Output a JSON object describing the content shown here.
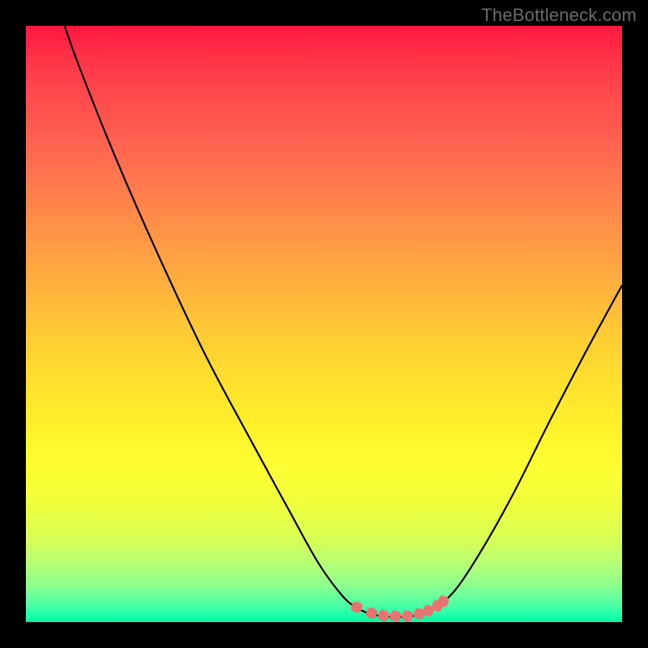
{
  "watermark": "TheBottleneck.com",
  "chart_data": {
    "type": "line",
    "title": "",
    "xlabel": "",
    "ylabel": "",
    "xlim": [
      0,
      100
    ],
    "ylim": [
      0,
      100
    ],
    "series": [
      {
        "name": "curve",
        "points": [
          {
            "x": 6.5,
            "y": 100.0
          },
          {
            "x": 9.0,
            "y": 93.0
          },
          {
            "x": 15.0,
            "y": 78.0
          },
          {
            "x": 22.0,
            "y": 62.0
          },
          {
            "x": 30.0,
            "y": 45.0
          },
          {
            "x": 38.0,
            "y": 30.0
          },
          {
            "x": 44.0,
            "y": 19.0
          },
          {
            "x": 49.0,
            "y": 10.0
          },
          {
            "x": 53.0,
            "y": 4.5
          },
          {
            "x": 55.5,
            "y": 2.4
          },
          {
            "x": 58.0,
            "y": 1.3
          },
          {
            "x": 61.0,
            "y": 0.9
          },
          {
            "x": 64.0,
            "y": 0.9
          },
          {
            "x": 67.0,
            "y": 1.5
          },
          {
            "x": 69.5,
            "y": 3.0
          },
          {
            "x": 72.5,
            "y": 6.0
          },
          {
            "x": 77.0,
            "y": 13.0
          },
          {
            "x": 82.0,
            "y": 22.0
          },
          {
            "x": 88.0,
            "y": 34.0
          },
          {
            "x": 94.0,
            "y": 45.5
          },
          {
            "x": 100.0,
            "y": 56.5
          }
        ]
      },
      {
        "name": "markers",
        "type": "scatter",
        "points": [
          {
            "x": 55.5,
            "y": 2.5
          },
          {
            "x": 58.0,
            "y": 1.5
          },
          {
            "x": 60.0,
            "y": 1.1
          },
          {
            "x": 62.0,
            "y": 1.0
          },
          {
            "x": 64.0,
            "y": 1.0
          },
          {
            "x": 66.0,
            "y": 1.4
          },
          {
            "x": 67.5,
            "y": 1.9
          },
          {
            "x": 69.0,
            "y": 2.7
          },
          {
            "x": 70.0,
            "y": 3.5
          }
        ]
      }
    ]
  },
  "colors": {
    "curve_stroke": "#000000",
    "marker_fill": "#e77471",
    "background_top": "#ff183f",
    "background_bottom": "#08f59c",
    "page_bg": "#000000",
    "watermark_color": "#6b6b6b"
  }
}
